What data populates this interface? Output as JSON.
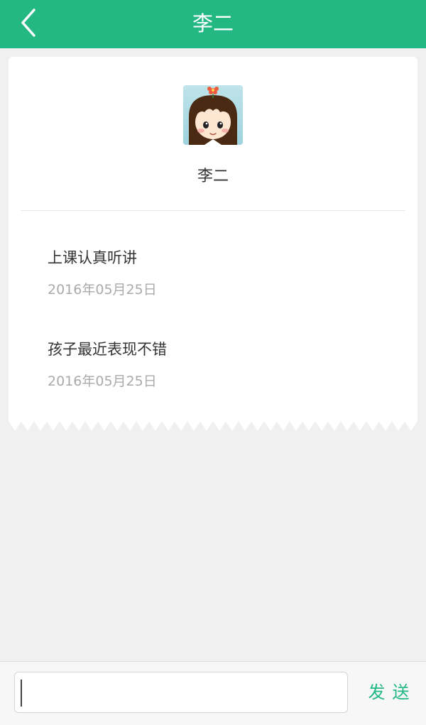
{
  "header": {
    "title": "李二",
    "back_icon": "chevron-left-icon",
    "color": "#22b783"
  },
  "profile": {
    "name": "李二",
    "avatar_icon": "cartoon-girl-avatar"
  },
  "comments": [
    {
      "text": "上课认真听讲",
      "date": "2016年05月25日"
    },
    {
      "text": "孩子最近表现不错",
      "date": "2016年05月25日"
    }
  ],
  "composer": {
    "input_value": "",
    "send_label": "发送"
  }
}
